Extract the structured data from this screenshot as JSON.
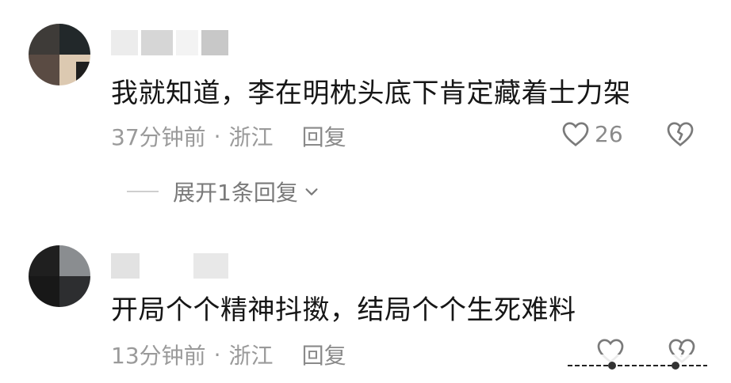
{
  "comments": [
    {
      "text": "我就知道，李在明枕头底下肯定藏着士力架",
      "time": "37分钟前",
      "separator": "·",
      "location": "浙江",
      "reply_label": "回复",
      "like_count": "26",
      "expand_label": "展开1条回复"
    },
    {
      "text": "开局个个精神抖擞，结局个个生死难料",
      "time": "13分钟前",
      "separator": "·",
      "location": "浙江",
      "reply_label": "回复"
    }
  ],
  "icons": {
    "like": "heart-outline-icon",
    "dislike": "broken-heart-icon",
    "expand": "chevron-down-icon"
  },
  "colors": {
    "text": "#161616",
    "meta": "#9a9a9a"
  }
}
